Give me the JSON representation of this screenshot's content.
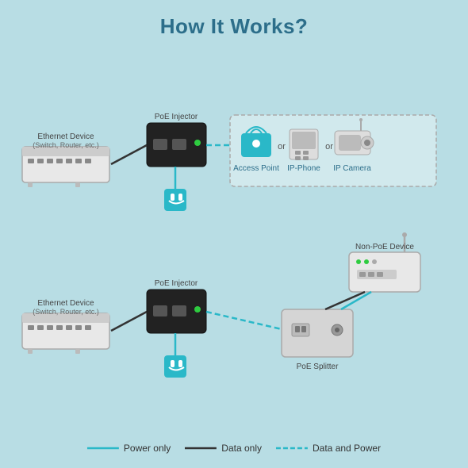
{
  "title": "How It Works?",
  "legend": {
    "power_only": "Power only",
    "data_only": "Data only",
    "data_and_power": "Data and Power"
  },
  "devices": {
    "poe_injector_top": "PoE Injector",
    "poe_injector_bottom": "PoE Injector",
    "ethernet_top": "Ethernet Device\n(Switch, Router, etc.)",
    "ethernet_bottom": "Ethernet Device\n(Switch, Router, etc.)",
    "non_poe": "Non-PoE Device",
    "poe_splitter": "PoE Splitter",
    "access_point": "Access Point",
    "ip_phone": "IP-Phone",
    "ip_camera": "IP Camera"
  }
}
